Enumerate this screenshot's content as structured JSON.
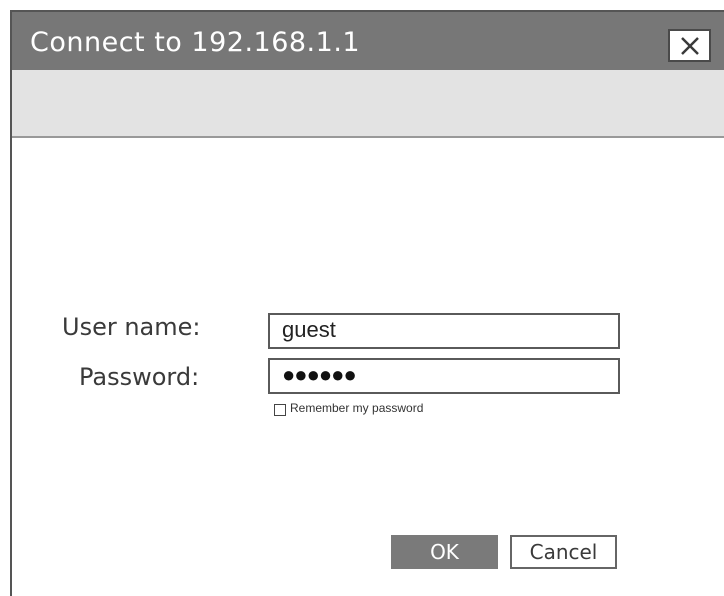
{
  "dialog": {
    "title": "Connect to 192.168.1.1",
    "close_icon": "close-icon"
  },
  "form": {
    "username_label": "User name:",
    "username_value": "guest",
    "password_label": "Password:",
    "password_value": "●●●●●●",
    "remember_label": "Remember my password",
    "remember_checked": false
  },
  "buttons": {
    "ok_label": "OK",
    "cancel_label": "Cancel"
  },
  "colors": {
    "titlebar": "#777777",
    "toolbar": "#e3e3e3",
    "ok_button": "#7a7a7a"
  }
}
